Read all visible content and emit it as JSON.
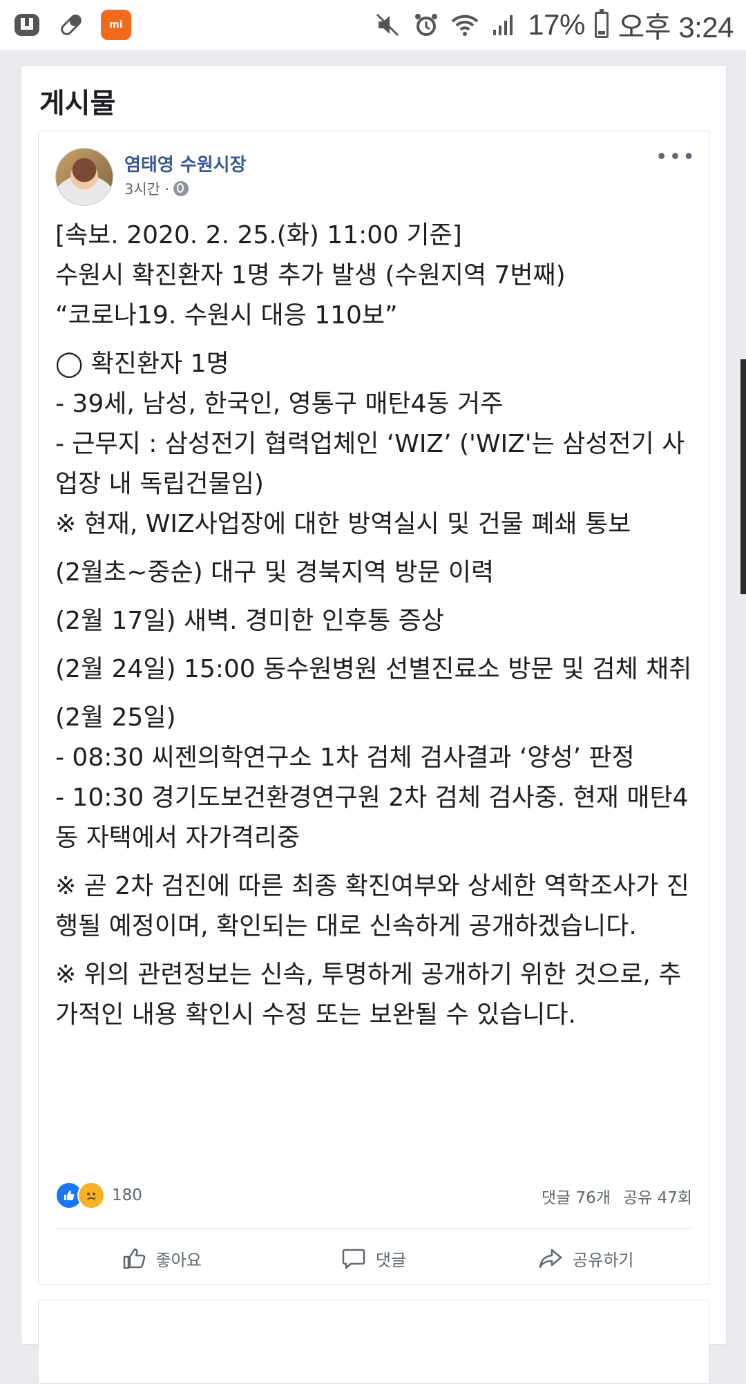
{
  "status_bar": {
    "left_icons": [
      "app-u-icon",
      "pill-icon",
      "mi-app-icon"
    ],
    "mi_label": "mi",
    "right_icons": [
      "mute-icon",
      "alarm-icon",
      "wifi-icon",
      "signal-icon"
    ],
    "battery": "17%",
    "battery_level": 0.17,
    "time": "오후 3:24"
  },
  "section": {
    "title": "게시물"
  },
  "post": {
    "author": "염태영 수원시장",
    "time": "3시간 ·",
    "more": "•••",
    "lines": [
      "[속보. 2020. 2. 25.(화) 11:00 기준]",
      "수원시 확진환자 1명 추가 발생 (수원지역 7번째)",
      "“코로나19. 수원시 대응 110보”",
      "◯ 확진환자 1명",
      "- 39세, 남성, 한국인, 영통구 매탄4동 거주",
      "- 근무지 : 삼성전기 협력업체인 ‘WIZ’ ('WIZ'는 삼성전기 사업장 내 독립건물임)",
      "※ 현재, WIZ사업장에 대한 방역실시 및 건물 폐쇄 통보",
      "(2월초~중순) 대구 및 경북지역 방문 이력",
      "(2월 17일) 새벽. 경미한 인후통 증상",
      "(2월 24일) 15:00 동수원병원 선별진료소 방문 및 검체 채취",
      "(2월 25일)",
      "- 08:30 씨젠의학연구소 1차 검체 검사결과 ‘양성’ 판정",
      "- 10:30 경기도보건환경연구원 2차 검체 검사중. 현재 매탄4동 자택에서 자가격리중",
      "※ 곧 2차 검진에 따른 최종 확진여부와 상세한 역학조사가 진행될 예정이며, 확인되는 대로 신속하게 공개하겠습니다.",
      "※ 위의 관련정보는 신속, 투명하게 공개하기 위한 것으로, 추가적인 내용 확인시 수정 또는 보완될 수 있습니다."
    ],
    "reaction_count": "180",
    "comments": "댓글 76개",
    "shares": "공유 47회",
    "actions": {
      "like": "좋아요",
      "comment": "댓글",
      "share": "공유하기"
    }
  }
}
